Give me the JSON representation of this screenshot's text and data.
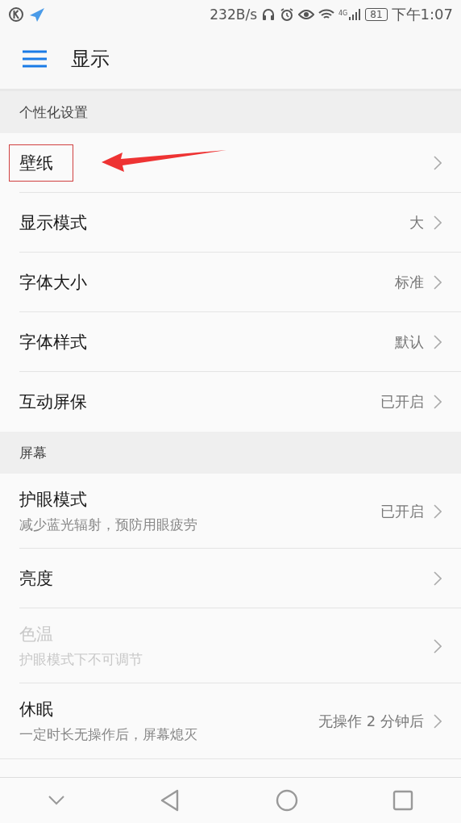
{
  "status_bar": {
    "speed": "232B/s",
    "network": "4G",
    "battery": "81",
    "time": "下午1:07"
  },
  "header": {
    "title": "显示"
  },
  "sections": [
    {
      "title": "个性化设置",
      "items": [
        {
          "title": "壁纸",
          "highlighted": true,
          "disabled": false
        },
        {
          "title": "显示模式",
          "value": "大",
          "highlighted": false,
          "disabled": false
        },
        {
          "title": "字体大小",
          "value": "标准",
          "highlighted": false,
          "disabled": false
        },
        {
          "title": "字体样式",
          "value": "默认",
          "highlighted": false,
          "disabled": false
        },
        {
          "title": "互动屏保",
          "value": "已开启",
          "highlighted": false,
          "disabled": false
        }
      ]
    },
    {
      "title": "屏幕",
      "items": [
        {
          "title": "护眼模式",
          "subtitle": "减少蓝光辐射，预防用眼疲劳",
          "value": "已开启",
          "highlighted": false,
          "disabled": false
        },
        {
          "title": "亮度",
          "highlighted": false,
          "disabled": false
        },
        {
          "title": "色温",
          "subtitle": "护眼模式下不可调节",
          "highlighted": false,
          "disabled": true
        },
        {
          "title": "休眠",
          "subtitle": "一定时长无操作后，屏幕熄灭",
          "value": "无操作 2 分钟后",
          "highlighted": false,
          "disabled": false
        }
      ]
    }
  ]
}
